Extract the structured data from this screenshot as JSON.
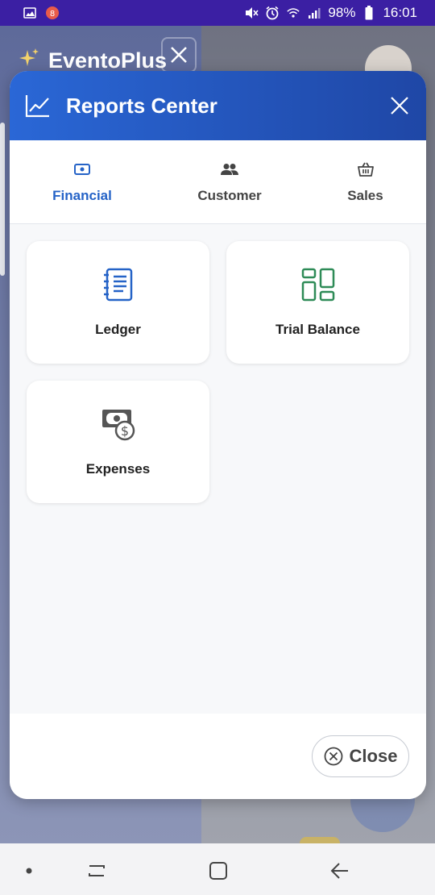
{
  "status_bar": {
    "battery": "98%",
    "time": "16:01",
    "icons": [
      "image-icon",
      "notification-icon",
      "mute-icon",
      "alarm-icon",
      "wifi-icon",
      "signal-icon",
      "battery-icon"
    ]
  },
  "background_app": {
    "brand": "EventoPlus"
  },
  "modal": {
    "title": "Reports Center",
    "header_icon": "chart-line-icon",
    "close_icon": "close-icon",
    "colors": {
      "header_start": "#2a67d6",
      "header_end": "#1f47a6",
      "accent": "#2563c7"
    }
  },
  "tabs": [
    {
      "label": "Financial",
      "icon": "money-icon",
      "active": true
    },
    {
      "label": "Customer",
      "icon": "users-icon",
      "active": false
    },
    {
      "label": "Sales",
      "icon": "basket-icon",
      "active": false
    }
  ],
  "cards": [
    {
      "label": "Ledger",
      "icon": "ledger-icon",
      "color": "#2563c7"
    },
    {
      "label": "Trial Balance",
      "icon": "grid-layout-icon",
      "color": "#2e8b57"
    },
    {
      "label": "Expenses",
      "icon": "cash-dollar-icon",
      "color": "#555555"
    }
  ],
  "footer": {
    "close_label": "Close",
    "close_icon": "circle-close-icon"
  },
  "nav_bar": {
    "items": [
      "dot-icon",
      "recents-icon",
      "home-icon",
      "back-icon"
    ]
  }
}
